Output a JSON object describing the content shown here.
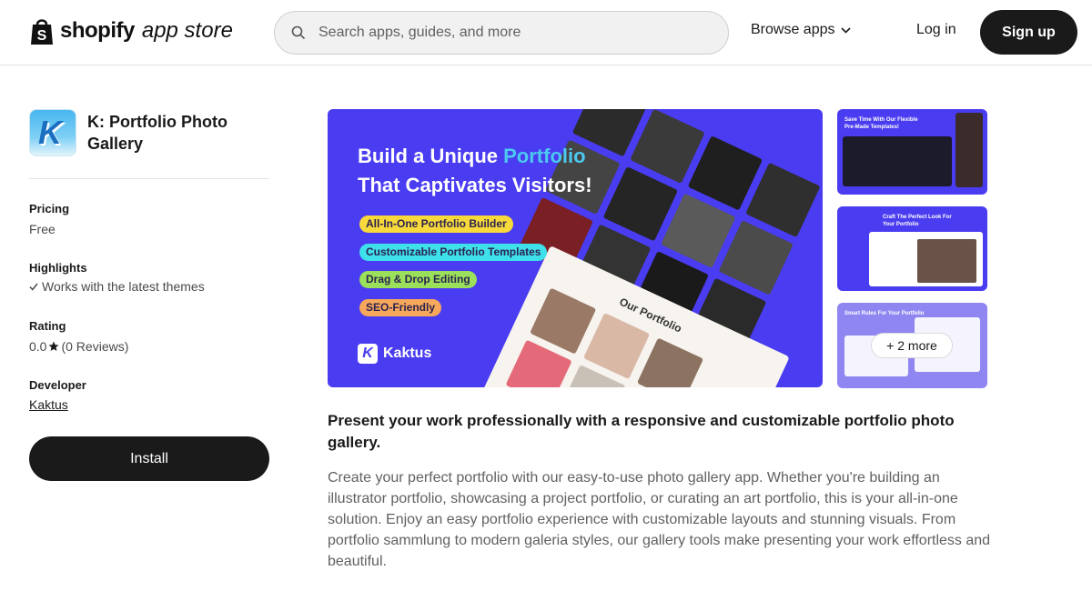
{
  "header": {
    "brand": "shopify",
    "store": "app store",
    "search_placeholder": "Search apps, guides, and more",
    "browse_label": "Browse apps",
    "login_label": "Log in",
    "signup_label": "Sign up"
  },
  "app": {
    "icon_letter": "K",
    "name": "K: Portfolio Photo Gallery",
    "pricing_label": "Pricing",
    "pricing_value": "Free",
    "highlights_label": "Highlights",
    "highlight_item": "Works with the latest themes",
    "rating_label": "Rating",
    "rating_value": "0.0",
    "reviews_text": "(0 Reviews)",
    "developer_label": "Developer",
    "developer_name": "Kaktus",
    "install_label": "Install"
  },
  "hero": {
    "line1_a": "Build a Unique ",
    "line1_accent": "Portfolio",
    "line2": "That Captivates Visitors!",
    "pills": [
      {
        "text": "All-In-One Portfolio Builder",
        "color": "#f7d93b"
      },
      {
        "text": "Customizable Portfolio Templates",
        "color": "#3ee0ea"
      },
      {
        "text": "Drag & Drop Editing",
        "color": "#9be05a"
      },
      {
        "text": "SEO-Friendly",
        "color": "#f7a85b"
      }
    ],
    "brand": "Kaktus",
    "card_title": "Our Portfolio"
  },
  "thumbs": {
    "t1_caption": "Save Time With Our Flexible Pre-Made Templates!",
    "t2_caption": "Craft The Perfect Look For Your Portfolio",
    "t3_caption": "Smart Rules For Your Portfolio",
    "more_label": "+ 2 more"
  },
  "content": {
    "tagline": "Present your work professionally with a responsive and customizable portfolio photo gallery.",
    "description": "Create your perfect portfolio with our easy-to-use photo gallery app. Whether you're building an illustrator portfolio, showcasing a project portfolio, or curating an art portfolio, this is your all-in-one solution. Enjoy an easy portfolio experience with customizable layouts and stunning visuals. From portfolio sammlung to modern galeria styles, our gallery tools make presenting your work effortless and beautiful."
  }
}
